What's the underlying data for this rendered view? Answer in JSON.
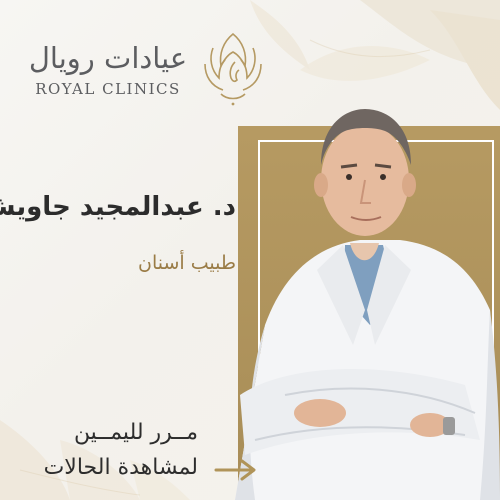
{
  "brand": {
    "name_ar": "عيادات رويال",
    "name_en": "ROYAL CLINICS",
    "logo_icon": "lotus-woman-face-icon",
    "color": "#5c5d60",
    "logo_color": "#b59a63"
  },
  "doctor": {
    "name": "د. عبدالمجيد جاويش",
    "title": "طبيب أسنان",
    "photo": "doctor-portrait"
  },
  "cta": {
    "line1": "مــرر لليمــين",
    "line2": "لمشاهدة الحالات",
    "arrow_icon": "arrow-right-icon"
  },
  "colors": {
    "gold": "#b09459",
    "text_dark": "#2c2c2c",
    "accent_text": "#9a7c46"
  }
}
